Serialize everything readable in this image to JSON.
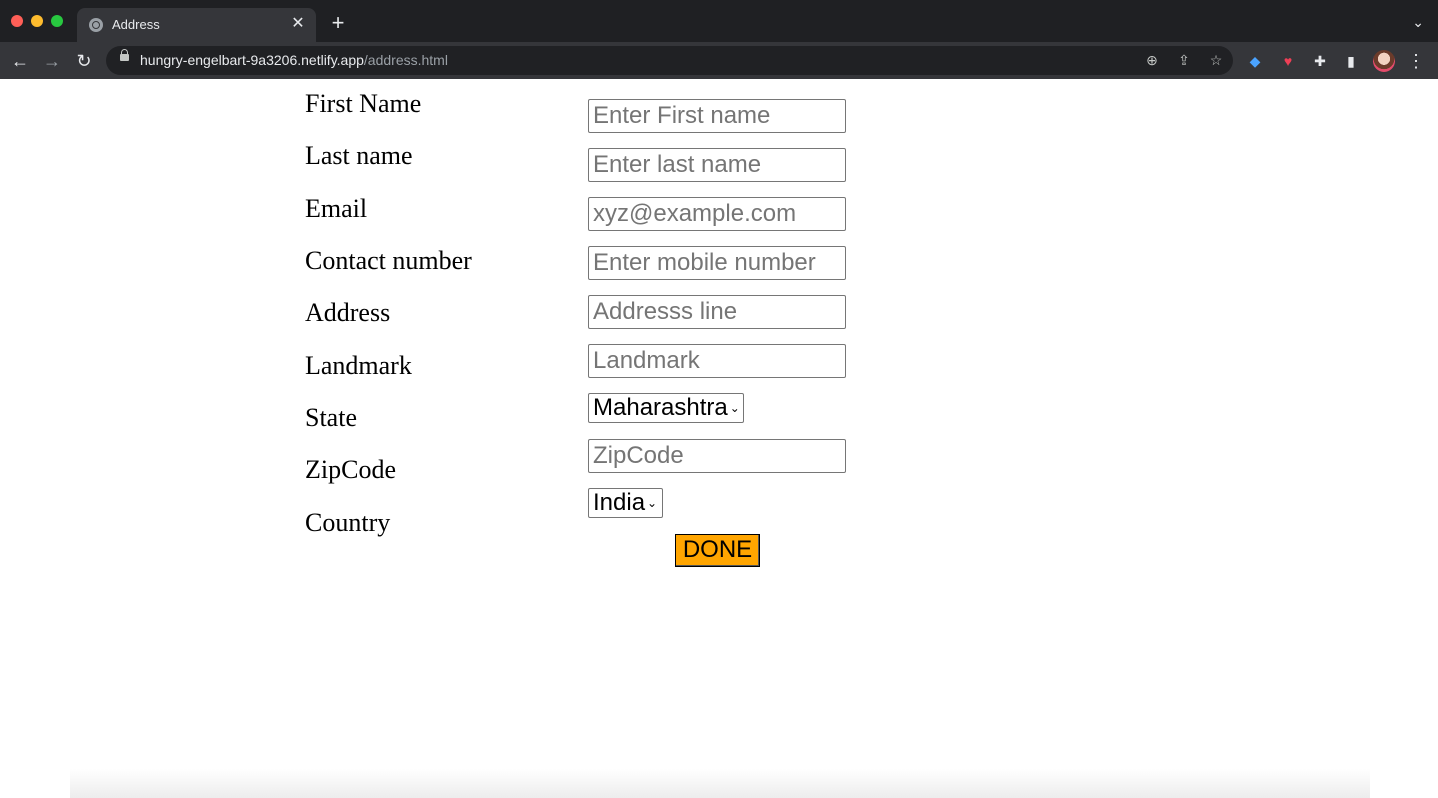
{
  "browser": {
    "tab_title": "Address",
    "url_host": "hungry-engelbart-9a3206.netlify.app",
    "url_path": "/address.html"
  },
  "form": {
    "fields": [
      {
        "label": "First Name",
        "placeholder": "Enter First name"
      },
      {
        "label": "Last name",
        "placeholder": "Enter last name"
      },
      {
        "label": "Email",
        "placeholder": "xyz@example.com"
      },
      {
        "label": "Contact number",
        "placeholder": "Enter mobile number"
      },
      {
        "label": "Address",
        "placeholder": "Addresss line"
      },
      {
        "label": "Landmark",
        "placeholder": "Landmark"
      },
      {
        "label": "ZipCode",
        "placeholder": "ZipCode"
      }
    ],
    "state_label": "State",
    "state_value": "Maharashtra",
    "country_label": "Country",
    "country_value": "India",
    "done_label": "DONE"
  },
  "colors": {
    "done_button": "#ffa500",
    "chrome_dark": "#202124"
  }
}
